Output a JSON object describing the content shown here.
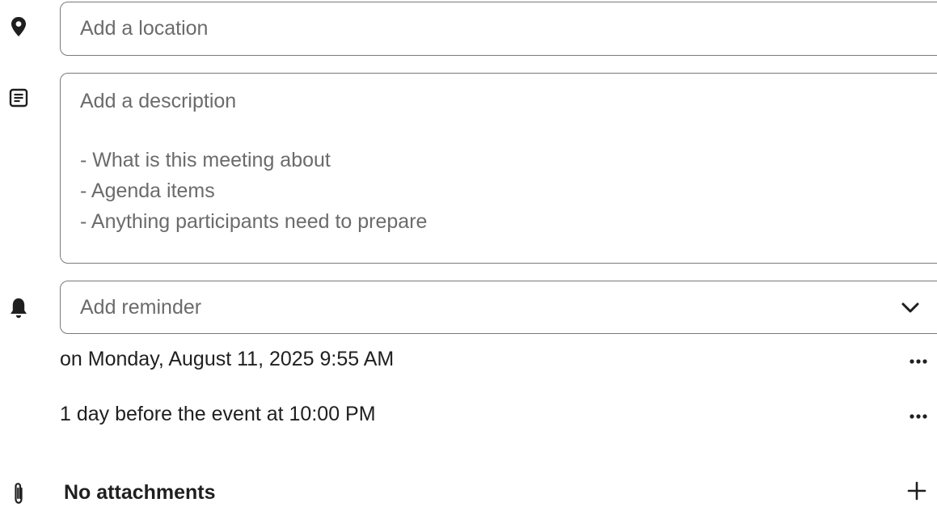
{
  "location": {
    "placeholder": "Add a location",
    "icon": "location-pin-icon"
  },
  "description": {
    "placeholder_lines": [
      "Add a description",
      "",
      "- What is this meeting about",
      "- Agenda items",
      "- Anything participants need to prepare"
    ],
    "icon": "notes-icon"
  },
  "reminder": {
    "placeholder": "Add reminder",
    "icon": "bell-icon",
    "dropdown_icon": "chevron-down-icon",
    "items": [
      {
        "label": "on Monday, August 11, 2025 9:55 AM",
        "menu_icon": "more-horizontal-icon"
      },
      {
        "label": "1 day before the event at 10:00 PM",
        "menu_icon": "more-horizontal-icon"
      }
    ]
  },
  "attachments": {
    "label": "No attachments",
    "icon": "paperclip-icon",
    "add_icon": "plus-icon"
  }
}
